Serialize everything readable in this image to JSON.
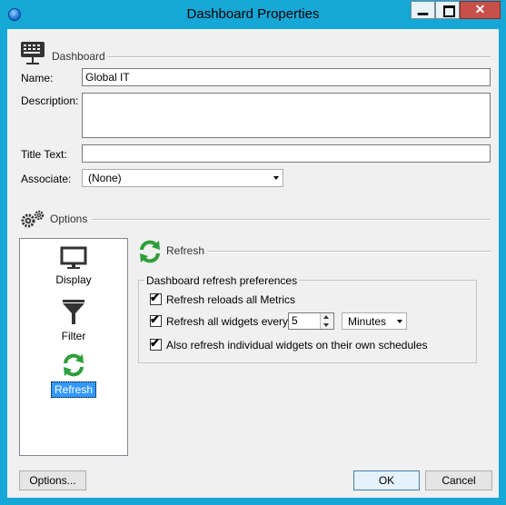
{
  "window": {
    "title": "Dashboard Properties",
    "minimize_glyph": "▁",
    "close_glyph": "✕"
  },
  "dashboard_section": {
    "header": "Dashboard",
    "name_label": "Name:",
    "name_value": "Global IT",
    "description_label": "Description:",
    "description_value": "",
    "title_text_label": "Title Text:",
    "title_text_value": "",
    "associate_label": "Associate:",
    "associate_value": "(None)"
  },
  "options_section": {
    "header": "Options",
    "nav": [
      {
        "label": "Display",
        "icon": "monitor-icon",
        "selected": false
      },
      {
        "label": "Filter",
        "icon": "funnel-icon",
        "selected": false
      },
      {
        "label": "Refresh",
        "icon": "refresh-icon",
        "selected": true
      }
    ]
  },
  "refresh_panel": {
    "header": "Refresh",
    "group_legend": "Dashboard refresh preferences",
    "opt_reload_metrics": {
      "label": "Refresh reloads all Metrics",
      "checked": true
    },
    "opt_refresh_every": {
      "label": "Refresh all widgets every:",
      "checked": true
    },
    "interval_value": "5",
    "interval_unit": "Minutes",
    "opt_individual": {
      "label": "Also refresh individual widgets on their own schedules",
      "checked": true
    }
  },
  "footer": {
    "options_button": "Options...",
    "ok_button": "OK",
    "cancel_button": "Cancel"
  },
  "colors": {
    "titlebar": "#15a7d6",
    "close_button": "#c7504a",
    "refresh_green": "#2e9e3a",
    "selection_blue": "#3399ff"
  }
}
